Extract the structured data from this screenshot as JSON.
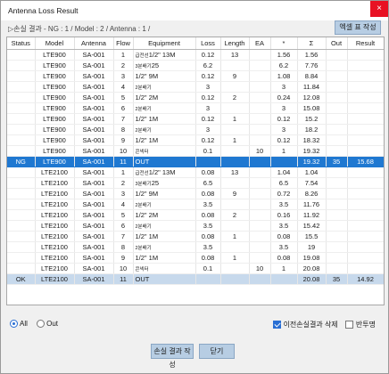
{
  "window": {
    "title": "Antenna Loss Result",
    "close_glyph": "×"
  },
  "info": {
    "text": "▷손실 결과 - NG : 1 / Model : 2 / Antenna : 1 /"
  },
  "toolbar": {
    "excel_label": "엑셀 표 작성"
  },
  "table": {
    "headers": [
      "Status",
      "Model",
      "Antenna",
      "Flow",
      "Equipment",
      "Loss",
      "Length",
      "EA",
      "*",
      "Σ",
      "Out",
      "Result"
    ],
    "rows": [
      {
        "status": "",
        "model": "LTE900",
        "antenna": "SA-001",
        "flow": "1",
        "equipment_kr": "급전선",
        "equipment": "1/2\" 13M",
        "loss": "0.12",
        "length": "13",
        "ea": "",
        "star": "1.56",
        "sigma": "1.56",
        "out": "",
        "result": "",
        "type": "normal"
      },
      {
        "status": "",
        "model": "LTE900",
        "antenna": "SA-001",
        "flow": "2",
        "equipment_kr": "3분배기",
        "equipment": "25",
        "loss": "6.2",
        "length": "",
        "ea": "",
        "star": "6.2",
        "sigma": "7.76",
        "out": "",
        "result": "",
        "type": "normal"
      },
      {
        "status": "",
        "model": "LTE900",
        "antenna": "SA-001",
        "flow": "3",
        "equipment_kr": "",
        "equipment": "1/2\" 9M",
        "loss": "0.12",
        "length": "9",
        "ea": "",
        "star": "1.08",
        "sigma": "8.84",
        "out": "",
        "result": "",
        "type": "normal"
      },
      {
        "status": "",
        "model": "LTE900",
        "antenna": "SA-001",
        "flow": "4",
        "equipment_kr": "2분배기",
        "equipment": "",
        "loss": "3",
        "length": "",
        "ea": "",
        "star": "3",
        "sigma": "11.84",
        "out": "",
        "result": "",
        "type": "normal"
      },
      {
        "status": "",
        "model": "LTE900",
        "antenna": "SA-001",
        "flow": "5",
        "equipment_kr": "",
        "equipment": "1/2\" 2M",
        "loss": "0.12",
        "length": "2",
        "ea": "",
        "star": "0.24",
        "sigma": "12.08",
        "out": "",
        "result": "",
        "type": "normal"
      },
      {
        "status": "",
        "model": "LTE900",
        "antenna": "SA-001",
        "flow": "6",
        "equipment_kr": "2분배기",
        "equipment": "",
        "loss": "3",
        "length": "",
        "ea": "",
        "star": "3",
        "sigma": "15.08",
        "out": "",
        "result": "",
        "type": "normal"
      },
      {
        "status": "",
        "model": "LTE900",
        "antenna": "SA-001",
        "flow": "7",
        "equipment_kr": "",
        "equipment": "1/2\" 1M",
        "loss": "0.12",
        "length": "1",
        "ea": "",
        "star": "0.12",
        "sigma": "15.2",
        "out": "",
        "result": "",
        "type": "normal"
      },
      {
        "status": "",
        "model": "LTE900",
        "antenna": "SA-001",
        "flow": "8",
        "equipment_kr": "2분배기",
        "equipment": "",
        "loss": "3",
        "length": "",
        "ea": "",
        "star": "3",
        "sigma": "18.2",
        "out": "",
        "result": "",
        "type": "normal"
      },
      {
        "status": "",
        "model": "LTE900",
        "antenna": "SA-001",
        "flow": "9",
        "equipment_kr": "",
        "equipment": "1/2\" 1M",
        "loss": "0.12",
        "length": "1",
        "ea": "",
        "star": "0.12",
        "sigma": "18.32",
        "out": "",
        "result": "",
        "type": "normal"
      },
      {
        "status": "",
        "model": "LTE900",
        "antenna": "SA-001",
        "flow": "10",
        "equipment_kr": "콘넥터",
        "equipment": "",
        "loss": "0.1",
        "length": "",
        "ea": "10",
        "star": "1",
        "sigma": "19.32",
        "out": "",
        "result": "",
        "type": "normal"
      },
      {
        "status": "NG",
        "model": "LTE900",
        "antenna": "SA-001",
        "flow": "11",
        "equipment_kr": "",
        "equipment": "OUT",
        "loss": "",
        "length": "",
        "ea": "",
        "star": "",
        "sigma": "19.32",
        "out": "35",
        "result": "15.68",
        "type": "selected"
      },
      {
        "status": "",
        "model": "LTE2100",
        "antenna": "SA-001",
        "flow": "1",
        "equipment_kr": "급전선",
        "equipment": "1/2\" 13M",
        "loss": "0.08",
        "length": "13",
        "ea": "",
        "star": "1.04",
        "sigma": "1.04",
        "out": "",
        "result": "",
        "type": "normal"
      },
      {
        "status": "",
        "model": "LTE2100",
        "antenna": "SA-001",
        "flow": "2",
        "equipment_kr": "3분배기",
        "equipment": "25",
        "loss": "6.5",
        "length": "",
        "ea": "",
        "star": "6.5",
        "sigma": "7.54",
        "out": "",
        "result": "",
        "type": "normal"
      },
      {
        "status": "",
        "model": "LTE2100",
        "antenna": "SA-001",
        "flow": "3",
        "equipment_kr": "",
        "equipment": "1/2\" 9M",
        "loss": "0.08",
        "length": "9",
        "ea": "",
        "star": "0.72",
        "sigma": "8.26",
        "out": "",
        "result": "",
        "type": "normal"
      },
      {
        "status": "",
        "model": "LTE2100",
        "antenna": "SA-001",
        "flow": "4",
        "equipment_kr": "2분배기",
        "equipment": "",
        "loss": "3.5",
        "length": "",
        "ea": "",
        "star": "3.5",
        "sigma": "11.76",
        "out": "",
        "result": "",
        "type": "normal"
      },
      {
        "status": "",
        "model": "LTE2100",
        "antenna": "SA-001",
        "flow": "5",
        "equipment_kr": "",
        "equipment": "1/2\" 2M",
        "loss": "0.08",
        "length": "2",
        "ea": "",
        "star": "0.16",
        "sigma": "11.92",
        "out": "",
        "result": "",
        "type": "normal"
      },
      {
        "status": "",
        "model": "LTE2100",
        "antenna": "SA-001",
        "flow": "6",
        "equipment_kr": "2분배기",
        "equipment": "",
        "loss": "3.5",
        "length": "",
        "ea": "",
        "star": "3.5",
        "sigma": "15.42",
        "out": "",
        "result": "",
        "type": "normal"
      },
      {
        "status": "",
        "model": "LTE2100",
        "antenna": "SA-001",
        "flow": "7",
        "equipment_kr": "",
        "equipment": "1/2\" 1M",
        "loss": "0.08",
        "length": "1",
        "ea": "",
        "star": "0.08",
        "sigma": "15.5",
        "out": "",
        "result": "",
        "type": "normal"
      },
      {
        "status": "",
        "model": "LTE2100",
        "antenna": "SA-001",
        "flow": "8",
        "equipment_kr": "2분배기",
        "equipment": "",
        "loss": "3.5",
        "length": "",
        "ea": "",
        "star": "3.5",
        "sigma": "19",
        "out": "",
        "result": "",
        "type": "normal"
      },
      {
        "status": "",
        "model": "LTE2100",
        "antenna": "SA-001",
        "flow": "9",
        "equipment_kr": "",
        "equipment": "1/2\" 1M",
        "loss": "0.08",
        "length": "1",
        "ea": "",
        "star": "0.08",
        "sigma": "19.08",
        "out": "",
        "result": "",
        "type": "normal"
      },
      {
        "status": "",
        "model": "LTE2100",
        "antenna": "SA-001",
        "flow": "10",
        "equipment_kr": "콘넥터",
        "equipment": "",
        "loss": "0.1",
        "length": "",
        "ea": "10",
        "star": "1",
        "sigma": "20.08",
        "out": "",
        "result": "",
        "type": "normal"
      },
      {
        "status": "OK",
        "model": "LTE2100",
        "antenna": "SA-001",
        "flow": "11",
        "equipment_kr": "",
        "equipment": "OUT",
        "loss": "",
        "length": "",
        "ea": "",
        "star": "",
        "sigma": "20.08",
        "out": "35",
        "result": "14.92",
        "type": "summary"
      }
    ]
  },
  "filter": {
    "all_label": "All",
    "out_label": "Out",
    "selected": "all"
  },
  "options": {
    "prev_delete_label": "이전손실결과 삭제",
    "prev_delete_checked": true,
    "semi_transparent_label": "반투명",
    "semi_transparent_checked": false
  },
  "buttons": {
    "report_label": "손실 결과 작성",
    "close_label": "닫기"
  },
  "colors": {
    "selected_row": "#1f78d1",
    "summary_row": "#c7d9ec",
    "button": "#b7cde3",
    "close_button": "#e81123"
  }
}
